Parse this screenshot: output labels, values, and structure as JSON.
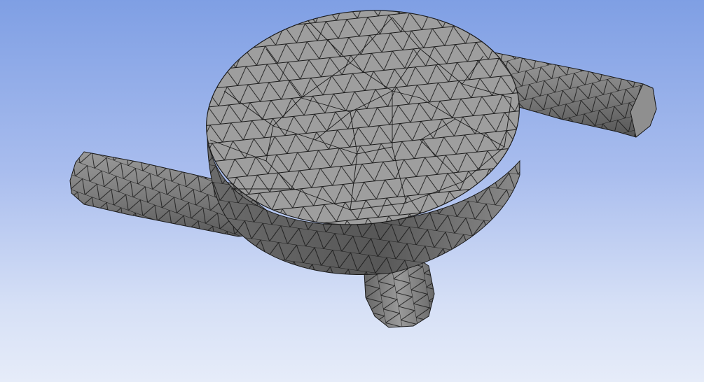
{
  "viewport": {
    "background_top": "#7f9fe4",
    "background_bottom": "#e6ecf9"
  },
  "model": {
    "face_color": "#9c9c9c",
    "face_dark": "#6e6e6e",
    "face_shadow": "#4a4a4a",
    "mesh_line_color": "#1a1a1a",
    "parts": [
      "main-disc",
      "left-pipe",
      "right-pipe",
      "bottom-pipe"
    ]
  }
}
